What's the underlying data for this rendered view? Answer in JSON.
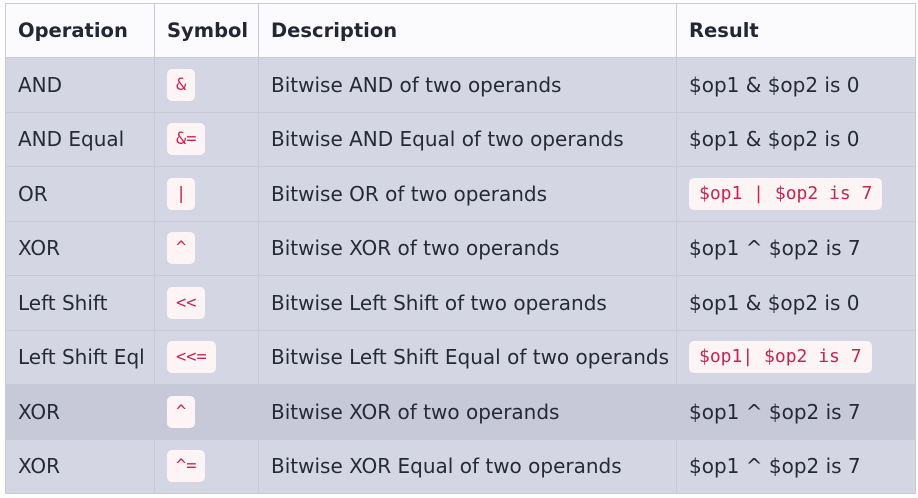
{
  "table": {
    "headers": [
      "Operation",
      "Symbol",
      "Description",
      "Result"
    ],
    "rows": [
      {
        "operation": "AND",
        "symbol": "&",
        "description": "Bitwise AND of two operands",
        "result": "$op1 & $op2 is 0",
        "result_is_code": false
      },
      {
        "operation": "AND Equal",
        "symbol": "&=",
        "description": "Bitwise AND Equal of two operands",
        "result": "$op1 & $op2 is 0",
        "result_is_code": false
      },
      {
        "operation": "OR",
        "symbol": "|",
        "description": "Bitwise OR of two operands",
        "result": "$op1 | $op2 is 7",
        "result_is_code": true
      },
      {
        "operation": "XOR",
        "symbol": "^",
        "description": "Bitwise XOR of two operands",
        "result": "$op1 ^ $op2 is 7",
        "result_is_code": false
      },
      {
        "operation": "Left Shift",
        "symbol": "<<",
        "description": "Bitwise Left Shift of two operands",
        "result": "$op1 & $op2 is 0",
        "result_is_code": false
      },
      {
        "operation": "Left Shift Eql",
        "symbol": "<<=",
        "description": "Bitwise Left Shift Equal of two operands",
        "result": "$op1| $op2 is 7",
        "result_is_code": true
      },
      {
        "operation": "XOR",
        "symbol": "^",
        "description": "Bitwise XOR of two operands",
        "result": "$op1 ^ $op2 is 7",
        "result_is_code": false
      },
      {
        "operation": "XOR",
        "symbol": "^=",
        "description": "Bitwise XOR Equal of two operands",
        "result": "$op1 ^ $op2 is 7",
        "result_is_code": false
      }
    ]
  },
  "colors": {
    "row_background": "#d5d6e3",
    "hover_row_background": "#c8c9d8",
    "header_background": "#fbfbfd",
    "code_text": "#c7254e",
    "code_background": "#fdf4f5"
  }
}
